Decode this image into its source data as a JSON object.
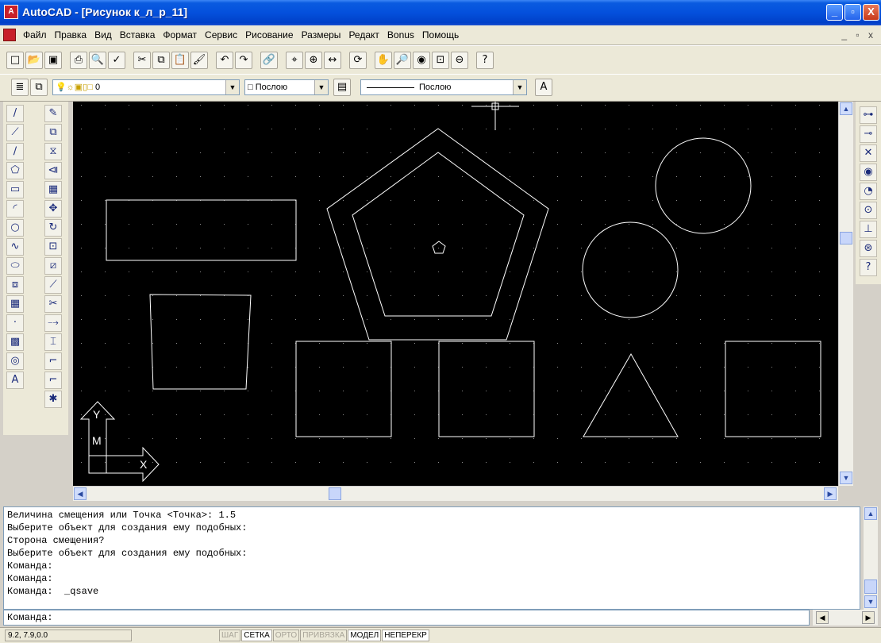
{
  "window": {
    "title": "AutoCAD - [Рисунок к_л_р_11]",
    "app_icon_label": "A",
    "controls": {
      "minimize": "_",
      "maximize": "▫",
      "close": "X"
    }
  },
  "menu": {
    "items": [
      "Файл",
      "Правка",
      "Вид",
      "Вставка",
      "Формат",
      "Сервис",
      "Рисование",
      "Размеры",
      "Редакт",
      "Bonus",
      "Помощь"
    ],
    "mdi_controls": "_ ▫ x"
  },
  "toolbar_layers": {
    "layer_value": "0",
    "color_value": "Послою",
    "linetype_value": "Послою",
    "layer_icons": "💡☼▣▯□"
  },
  "colors": {
    "canvas_bg": "#000000",
    "entity": "#ffffff",
    "grid": "#8c8c8c",
    "titlebar": "#0450dc",
    "ucs": "#ffffff"
  },
  "ucs_icon": {
    "y_label": "Y",
    "x_label": "X",
    "w_label": "M"
  },
  "command_history": [
    "Величина смещения или Точка <Точка>: 1.5",
    "Выберите объект для создания ему подобных:",
    "Сторона смещения?",
    "Выберите объект для создания ему подобных:",
    "Команда:",
    "Команда:",
    "Команда:  _qsave"
  ],
  "command_prompt": "Команда:",
  "status": {
    "coords": "9.2, 7.9,0.0",
    "buttons": [
      {
        "label": "ШАГ",
        "state": "off"
      },
      {
        "label": "СЕТКА",
        "state": "on"
      },
      {
        "label": "ОРТО",
        "state": "off"
      },
      {
        "label": "ПРИВЯЗКА",
        "state": "off"
      },
      {
        "label": "МОДЕЛ",
        "state": "on"
      },
      {
        "label": "НЕПЕРЕКР",
        "state": "on"
      }
    ]
  },
  "toolbar_icons": {
    "standard": [
      "new-icon",
      "open-icon",
      "save-icon",
      "print-icon",
      "preview-icon",
      "spell-icon",
      "cut-icon",
      "copy-icon",
      "paste-icon",
      "match-icon",
      "undo-icon",
      "redo-icon",
      "hyperlink-icon",
      "snap-icon",
      "ucs-icon",
      "distance-icon",
      "redraw-icon",
      "pan-icon",
      "zoom-realtime-icon",
      "aerial-icon",
      "zoom-window-icon",
      "zoom-previous-icon",
      "help-icon"
    ],
    "draw": [
      "line-icon",
      "construction-line-icon",
      "polyline-icon",
      "polygon-icon",
      "rectangle-icon",
      "arc-icon",
      "circle-icon",
      "spline-icon",
      "ellipse-icon",
      "insert-block-icon",
      "make-block-icon",
      "point-icon",
      "hatch-icon",
      "region-icon",
      "text-icon"
    ],
    "modify": [
      "erase-icon",
      "copy-object-icon",
      "mirror-icon",
      "offset-icon",
      "array-icon",
      "move-icon",
      "rotate-icon",
      "scale-icon",
      "stretch-icon",
      "lengthen-icon",
      "trim-icon",
      "extend-icon",
      "break-icon",
      "chamfer-icon",
      "fillet-icon",
      "explode-icon"
    ],
    "object_snap": [
      "snap-endpoint-icon",
      "snap-midpoint-icon",
      "snap-intersection-icon",
      "snap-center-icon",
      "snap-quadrant-icon",
      "snap-tangent-icon",
      "snap-perpendicular-icon",
      "snap-node-icon",
      "snap-insert-icon"
    ]
  },
  "icon_glyphs": {
    "std": [
      "□",
      "📂",
      "▣",
      "⎙",
      "🔍",
      "✓",
      "✂",
      "⧉",
      "📋",
      "🖌",
      "↶",
      "↷",
      "🔗",
      "⌖",
      "⊕",
      "↔",
      "⟳",
      "✋",
      "🔎",
      "◉",
      "⊡",
      "⊖",
      "?"
    ],
    "draw": [
      "/",
      "⟋",
      "∕",
      "⬠",
      "▭",
      "◜",
      "○",
      "∿",
      "⬭",
      "⧈",
      "▦",
      "·",
      "▩",
      "◎",
      "A"
    ],
    "modify": [
      "✎",
      "⧉",
      "⧖",
      "⧏",
      "▦",
      "✥",
      "↻",
      "⊡",
      "⧄",
      "⟋",
      "✂",
      "⤍",
      "⌶",
      "⌐",
      "⌐",
      "✱"
    ],
    "snap": [
      "⊶",
      "⊸",
      "✕",
      "◉",
      "◔",
      "⊙",
      "⊥",
      "⊛",
      "?"
    ]
  },
  "scroll_glyphs": {
    "up": "▲",
    "down": "▼",
    "left": "◀",
    "right": "▶"
  }
}
